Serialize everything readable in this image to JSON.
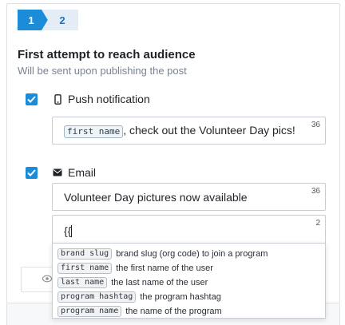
{
  "stepper": {
    "steps": [
      {
        "label": "1",
        "active": true
      },
      {
        "label": "2",
        "active": false
      }
    ]
  },
  "section": {
    "title": "First attempt to reach audience",
    "subtitle": "Will be sent upon publishing the post"
  },
  "push": {
    "checked": true,
    "icon": "phone-icon",
    "label": "Push notification",
    "message": {
      "token": "first name",
      "text": ", check out the Volunteer Day pics!",
      "count": "36"
    }
  },
  "email": {
    "checked": true,
    "icon": "envelope-icon",
    "label": "Email",
    "subject": {
      "text": "Volunteer Day pictures now available",
      "count": "36"
    },
    "body": {
      "text": "{{",
      "count": "2"
    }
  },
  "suggestions": [
    {
      "tag": "brand slug",
      "description": "brand slug (org code) to join a program"
    },
    {
      "tag": "first name",
      "description": "the first name of the user"
    },
    {
      "tag": "last name",
      "description": "the last name of the user"
    },
    {
      "tag": "program hashtag",
      "description": "the program hashtag"
    },
    {
      "tag": "program name",
      "description": "the name of the program"
    }
  ],
  "colors": {
    "accent": "#1c8cd8",
    "step_inactive": "#e4edf5"
  }
}
